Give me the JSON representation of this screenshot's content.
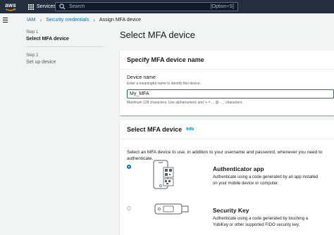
{
  "nav": {
    "logo_text": "aws",
    "services_label": "Services",
    "search_placeholder": "Search",
    "search_shortcut": "[Option+S]"
  },
  "breadcrumb": {
    "items": [
      "IAM",
      "Security credentials",
      "Assign MFA device"
    ]
  },
  "steps": [
    {
      "number": "Step 1",
      "name": "Select MFA device",
      "active": true
    },
    {
      "number": "Step 2",
      "name": "Set up device",
      "active": false
    }
  ],
  "page_title": "Select MFA device",
  "name_panel": {
    "title": "Specify MFA device name",
    "field_label": "Device name",
    "field_description": "Enter a meaningful name to identify this device.",
    "field_value": "My_MFA",
    "constraint": "Maximum 128 characters. Use alphanumeric and '+ = , . @ - _' characters."
  },
  "device_panel": {
    "title": "Select MFA device",
    "info_label": "Info",
    "intro": "Select an MFA device to use, in addition to your username and password, whenever you need to authenticate.",
    "options": [
      {
        "title": "Authenticator app",
        "description": "Authenticate using a code generated by an app installed on your mobile device or computer.",
        "selected": true,
        "icon": "authenticator-app-icon"
      },
      {
        "title": "Security Key",
        "description": "Authenticate using a code generated by touching a YubiKey or other supported FIDO security key.",
        "selected": false,
        "icon": "security-key-icon"
      }
    ]
  },
  "colors": {
    "nav_bg": "#232f3e",
    "link": "#0073bb",
    "page_bg": "#f2f3f3",
    "aws_orange": "#ff9900"
  }
}
